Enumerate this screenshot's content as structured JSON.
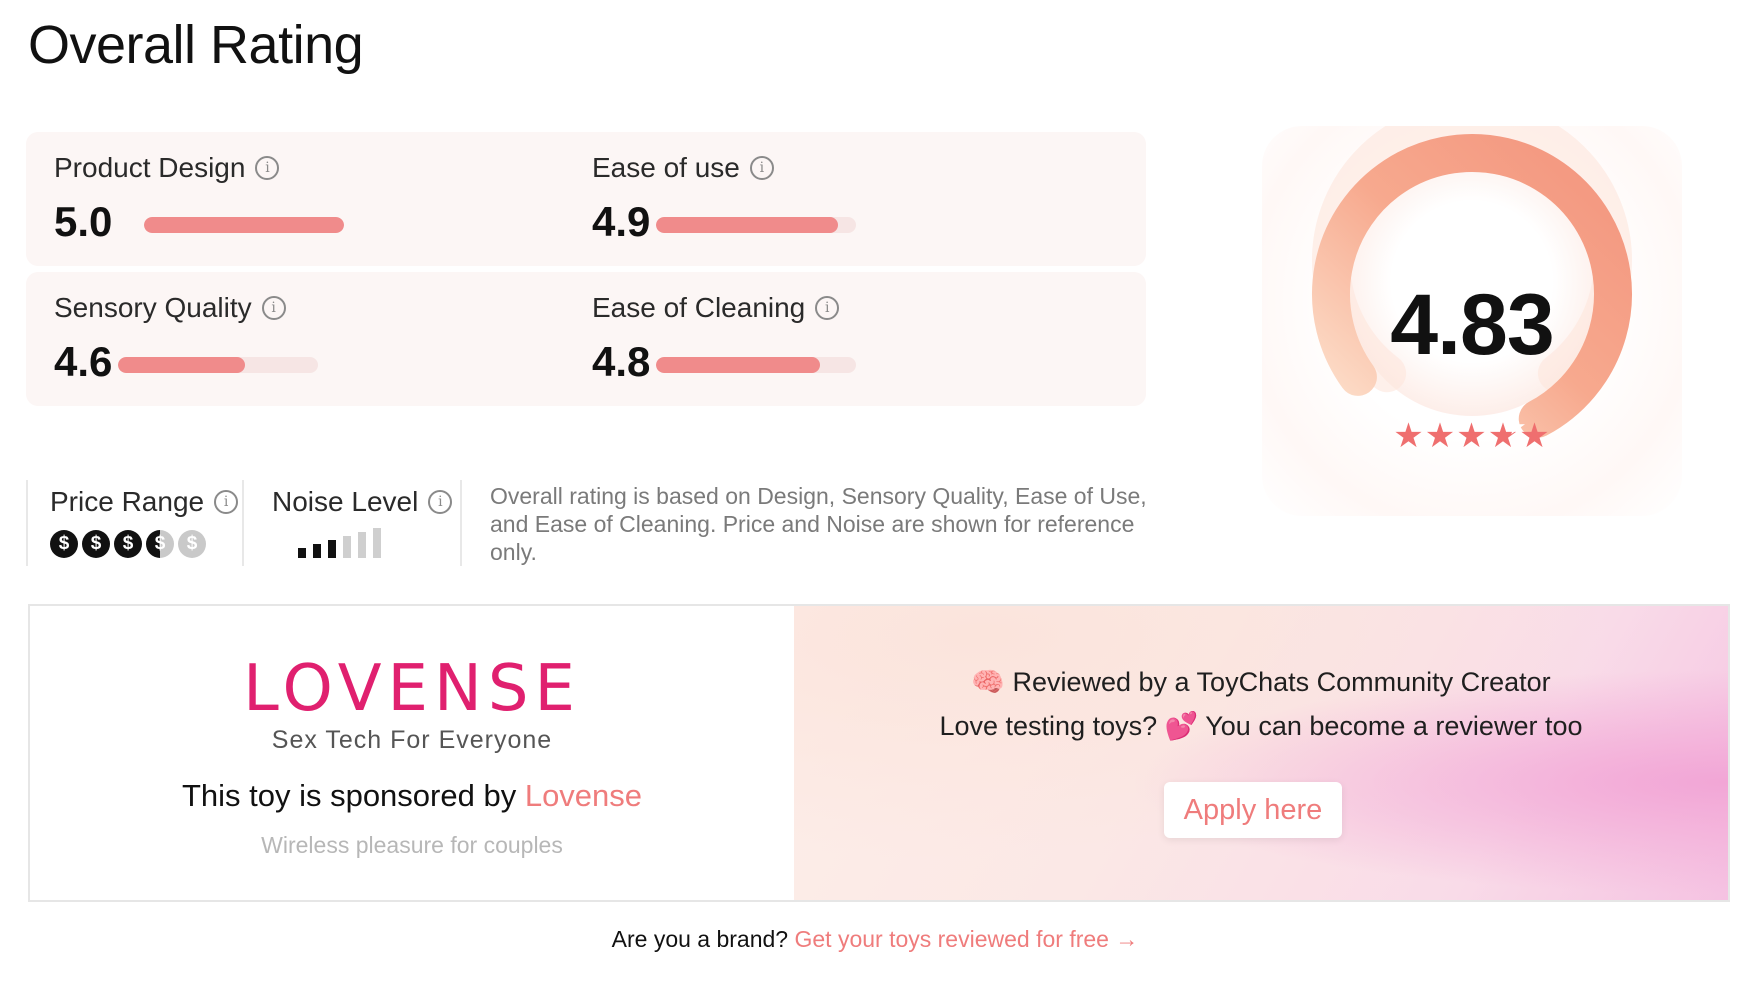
{
  "page": {
    "title": "Overall Rating"
  },
  "ratings": [
    {
      "label": "Product Design",
      "value": "5.0",
      "score": 5.0
    },
    {
      "label": "Ease of use",
      "value": "4.9",
      "score": 4.9
    },
    {
      "label": "Sensory Quality",
      "value": "4.6",
      "score": 4.6
    },
    {
      "label": "Ease of Cleaning",
      "value": "4.8",
      "score": 4.8
    }
  ],
  "rating_max": 5,
  "price": {
    "label": "Price Range",
    "symbol": "$",
    "level": 3.5,
    "max": 5
  },
  "noise": {
    "label": "Noise Level",
    "level": 3,
    "max": 6
  },
  "note": "Overall rating is based on Design, Sensory Quality, Ease of Use, and Ease of Cleaning. Price and Noise are shown for reference only.",
  "overall": {
    "value": "4.83",
    "score": 4.83,
    "max": 5,
    "stars": "★★★★★",
    "end_star": "★"
  },
  "sponsor": {
    "logo": "LOVENSE",
    "tagline": "Sex Tech For Everyone",
    "sponsored_prefix": "This toy is sponsored by ",
    "brand_name": "Lovense",
    "subtitle": "Wireless pleasure for couples"
  },
  "community": {
    "creator_line": "🧠 Reviewed by a ToyChats Community Creator",
    "reviewer_line": "Love testing toys? 💕 You can become a reviewer too",
    "apply_label": "Apply here"
  },
  "footer": {
    "question": "Are you a brand? ",
    "cta": "Get your toys reviewed for free →"
  },
  "colors": {
    "accent": "#ef7c7c",
    "bar": "#f08b8b",
    "brand": "#e0206f"
  },
  "icons": {
    "info": "info-icon"
  }
}
